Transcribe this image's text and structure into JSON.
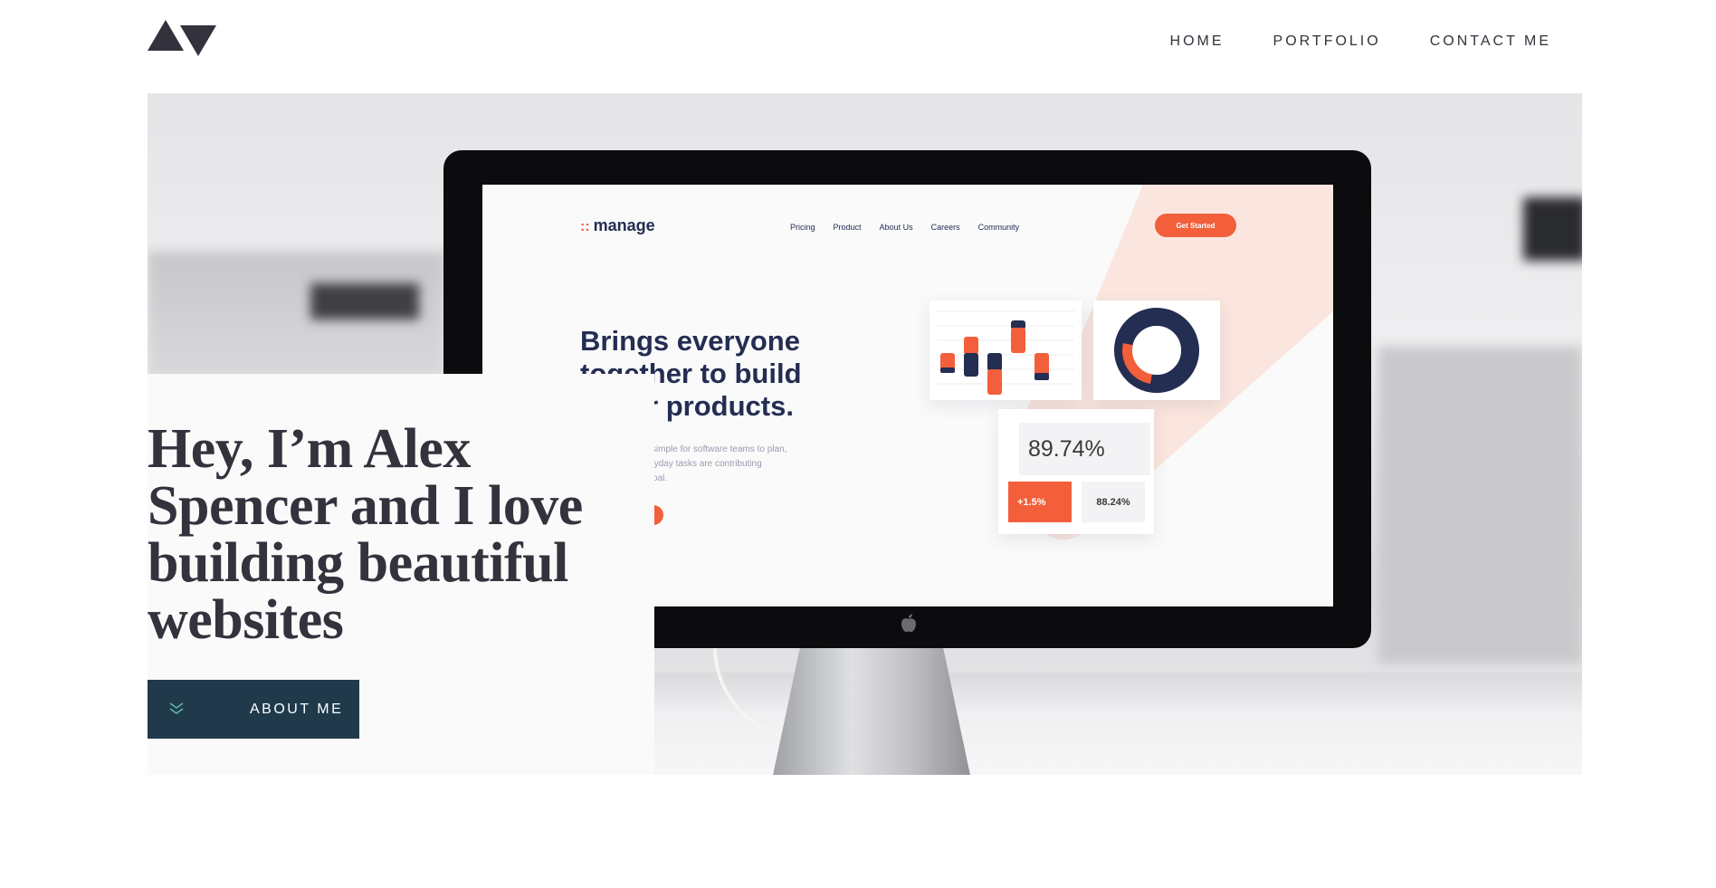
{
  "header": {
    "logo_icon": "av-triangles-logo",
    "nav": [
      {
        "label": "HOME"
      },
      {
        "label": "PORTFOLIO"
      },
      {
        "label": "CONTACT ME"
      }
    ]
  },
  "hero": {
    "image_description_icon": "imac-on-desk-photo",
    "screen": {
      "logo": "manage",
      "nav": [
        "Pricing",
        "Product",
        "About Us",
        "Careers",
        "Community"
      ],
      "cta": "Get Started",
      "heading": "Brings everyone together to build better products.",
      "paragraph": "Manage makes it simple for software teams to plan, see how their everyday tasks are contributing towards a larger goal.",
      "stat_main": "89.74%",
      "stat_change": "+1.5%",
      "stat_secondary": "88.24%"
    },
    "headline": "Hey, I’m Alex Spencer and I love building beautiful websites",
    "cta_label": "ABOUT ME",
    "cta_icon": "double-chevron-down-icon"
  },
  "colors": {
    "text_dark": "#33323d",
    "button_bg": "#203a4c",
    "accent_orange": "#f25f3a",
    "accent_navy": "#242d52"
  }
}
